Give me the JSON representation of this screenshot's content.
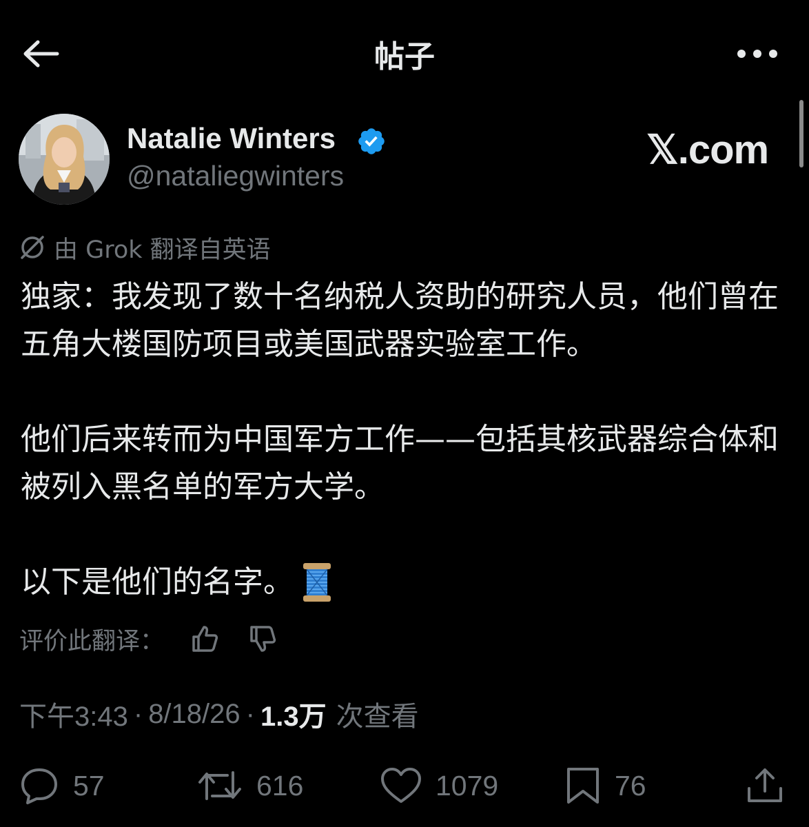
{
  "header": {
    "title": "帖子"
  },
  "author": {
    "name": "Natalie Winters",
    "handle": "@nataliegwinters",
    "verified": true
  },
  "watermark": "𝕏.com",
  "translation": {
    "notice": "由 Grok 翻译自英语",
    "rate_label": "评价此翻译："
  },
  "post": {
    "paragraph1": "独家：我发现了数十名纳税人资助的研究人员，他们曾在五角大楼国防项目或美国武器实验室工作。",
    "paragraph2": "他们后来转而为中国军方工作——包括其核武器综合体和被列入黑名单的军方大学。",
    "paragraph3": "以下是他们的名字。",
    "emoji": "thread-spool"
  },
  "meta": {
    "time": "下午3:43",
    "date": "8/18/26",
    "views": "1.3万",
    "views_label": "次查看"
  },
  "actions": {
    "replies": "57",
    "reposts": "616",
    "likes": "1079",
    "bookmarks": "76"
  },
  "colors": {
    "background": "#000000",
    "text_primary": "#e7e9ea",
    "text_secondary": "#71767b",
    "verified_badge": "#1d9bf0"
  }
}
